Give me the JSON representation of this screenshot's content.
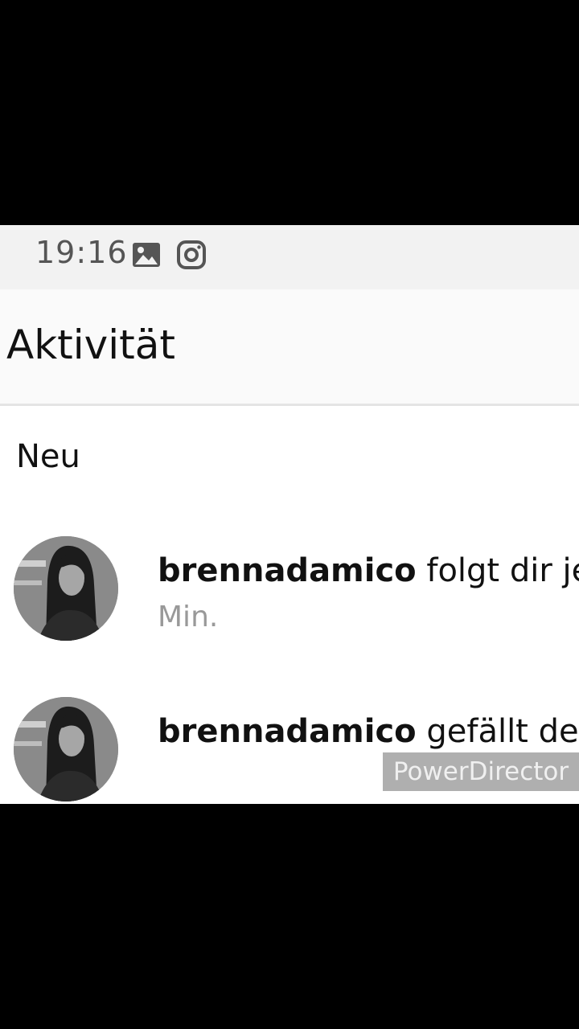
{
  "status_bar": {
    "time": "19:16",
    "icons": [
      "image-icon",
      "instagram-icon"
    ]
  },
  "header": {
    "title": "Aktivität"
  },
  "section": {
    "label": "Neu"
  },
  "activities": [
    {
      "username": "brennadamico",
      "action": " folgt dir jetz",
      "time": "Min."
    },
    {
      "username": "brennadamico",
      "action": " gefällt dein"
    }
  ],
  "watermark": {
    "text": "PowerDirector"
  }
}
